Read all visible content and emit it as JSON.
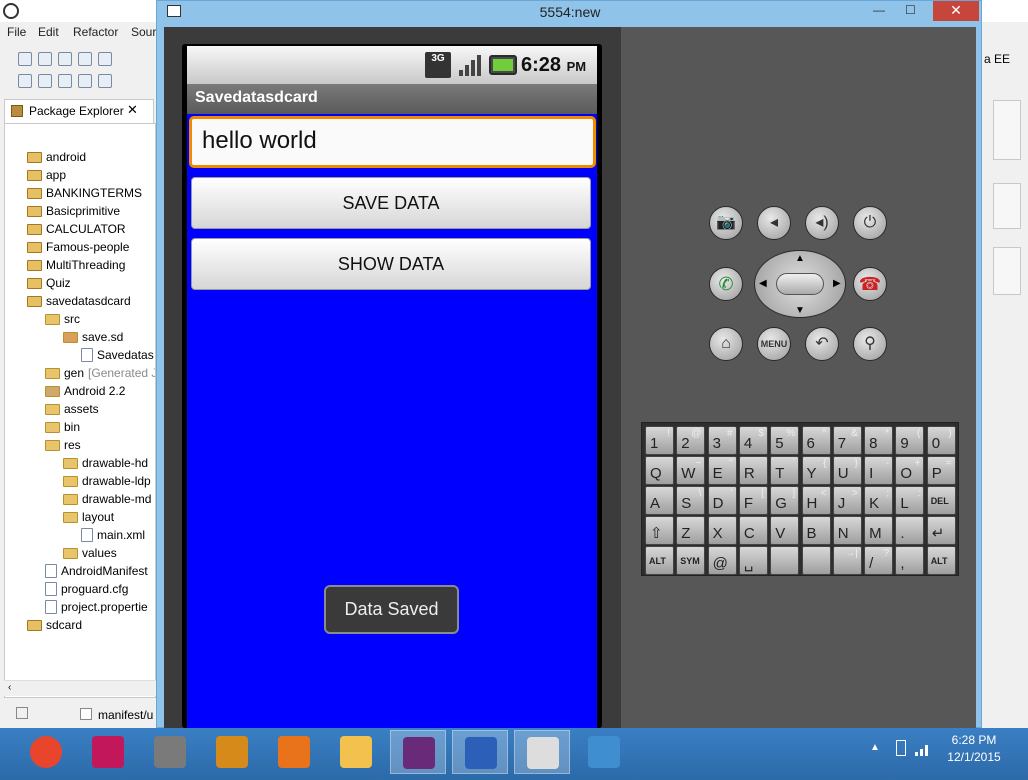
{
  "eclipse": {
    "menu": [
      "File",
      "Edit",
      "Refactor",
      "Sour"
    ],
    "right_fragment": "a EE",
    "package_explorer": {
      "title": "Package Explorer",
      "tree": [
        {
          "label": "android",
          "indent": 0,
          "icon": "project"
        },
        {
          "label": "app",
          "indent": 0,
          "icon": "project"
        },
        {
          "label": "BANKINGTERMS",
          "indent": 0,
          "icon": "project"
        },
        {
          "label": "Basicprimitive",
          "indent": 0,
          "icon": "project"
        },
        {
          "label": "CALCULATOR",
          "indent": 0,
          "icon": "project"
        },
        {
          "label": "Famous-people",
          "indent": 0,
          "icon": "project"
        },
        {
          "label": "MultiThreading",
          "indent": 0,
          "icon": "project"
        },
        {
          "label": "Quiz",
          "indent": 0,
          "icon": "project"
        },
        {
          "label": "savedatasdcard",
          "indent": 0,
          "icon": "project"
        },
        {
          "label": "src",
          "indent": 1,
          "icon": "folder"
        },
        {
          "label": "save.sd",
          "indent": 2,
          "icon": "package"
        },
        {
          "label": "Savedatas",
          "indent": 3,
          "icon": "file"
        },
        {
          "label": "gen",
          "suffix": "[Generated J",
          "indent": 1,
          "icon": "folder"
        },
        {
          "label": "Android 2.2",
          "indent": 1,
          "icon": "jar"
        },
        {
          "label": "assets",
          "indent": 1,
          "icon": "folder"
        },
        {
          "label": "bin",
          "indent": 1,
          "icon": "folder"
        },
        {
          "label": "res",
          "indent": 1,
          "icon": "folder"
        },
        {
          "label": "drawable-hd",
          "indent": 2,
          "icon": "folder"
        },
        {
          "label": "drawable-ldp",
          "indent": 2,
          "icon": "folder"
        },
        {
          "label": "drawable-md",
          "indent": 2,
          "icon": "folder"
        },
        {
          "label": "layout",
          "indent": 2,
          "icon": "folder"
        },
        {
          "label": "main.xml",
          "indent": 3,
          "icon": "file"
        },
        {
          "label": "values",
          "indent": 2,
          "icon": "folder"
        },
        {
          "label": "AndroidManifest",
          "indent": 1,
          "icon": "file"
        },
        {
          "label": "proguard.cfg",
          "indent": 1,
          "icon": "file"
        },
        {
          "label": "project.propertie",
          "indent": 1,
          "icon": "file"
        },
        {
          "label": "sdcard",
          "indent": 0,
          "icon": "project"
        }
      ]
    },
    "bottom_tab": "manifest/u"
  },
  "emulator": {
    "window_title": "5554:new",
    "status": {
      "network": "3G",
      "time": "6:28",
      "ampm": "PM"
    },
    "app": {
      "title": "Savedatasdcard",
      "edit_value": "hello world",
      "save_button": "SAVE DATA",
      "show_button": "SHOW DATA",
      "toast": "Data Saved"
    },
    "controls": {
      "menu_label": "MENU"
    },
    "keyboard": [
      [
        {
          "m": "1",
          "s": "!"
        },
        {
          "m": "2",
          "s": "@"
        },
        {
          "m": "3",
          "s": "#"
        },
        {
          "m": "4",
          "s": "$"
        },
        {
          "m": "5",
          "s": "%"
        },
        {
          "m": "6",
          "s": "^"
        },
        {
          "m": "7",
          "s": "&"
        },
        {
          "m": "8",
          "s": "*"
        },
        {
          "m": "9",
          "s": "("
        },
        {
          "m": "0",
          "s": ")"
        }
      ],
      [
        {
          "m": "Q",
          "s": ""
        },
        {
          "m": "W",
          "s": "~"
        },
        {
          "m": "E",
          "s": "\""
        },
        {
          "m": "R",
          "s": ""
        },
        {
          "m": "T",
          "s": "`"
        },
        {
          "m": "Y",
          "s": "{"
        },
        {
          "m": "U",
          "s": "}"
        },
        {
          "m": "I",
          "s": "-"
        },
        {
          "m": "O",
          "s": "+"
        },
        {
          "m": "P",
          "s": "="
        }
      ],
      [
        {
          "m": "A",
          "s": ""
        },
        {
          "m": "S",
          "s": "\\"
        },
        {
          "m": "D",
          "s": "'"
        },
        {
          "m": "F",
          "s": "["
        },
        {
          "m": "G",
          "s": "]"
        },
        {
          "m": "H",
          "s": "<"
        },
        {
          "m": "J",
          "s": ">"
        },
        {
          "m": "K",
          "s": ";"
        },
        {
          "m": "L",
          "s": ":"
        },
        {
          "m": "DEL",
          "s": ""
        }
      ],
      [
        {
          "m": "⇧",
          "s": ""
        },
        {
          "m": "Z",
          "s": ""
        },
        {
          "m": "X",
          "s": ""
        },
        {
          "m": "C",
          "s": ""
        },
        {
          "m": "V",
          "s": ""
        },
        {
          "m": "B",
          "s": ""
        },
        {
          "m": "N",
          "s": ""
        },
        {
          "m": "M",
          "s": ""
        },
        {
          "m": ".",
          "s": ""
        },
        {
          "m": "↵",
          "s": ""
        }
      ],
      [
        {
          "m": "ALT",
          "s": ""
        },
        {
          "m": "SYM",
          "s": ""
        },
        {
          "m": "@",
          "s": ""
        },
        {
          "m": "␣",
          "s": ""
        },
        {
          "m": "",
          "s": ""
        },
        {
          "m": "",
          "s": ""
        },
        {
          "m": "",
          "s": "→|"
        },
        {
          "m": "/",
          "s": "?"
        },
        {
          "m": ",",
          "s": ""
        },
        {
          "m": "ALT",
          "s": ""
        }
      ]
    ]
  },
  "taskbar": {
    "apps": [
      "chrome-icon",
      "help-icon",
      "firewall-icon",
      "winword-icon",
      "firefox-icon",
      "explorer-icon",
      "javaee-ide-icon",
      "word-icon",
      "eclipse-window-icon",
      "paint-icon"
    ],
    "active": [
      6,
      7,
      8
    ],
    "time": "6:28 PM",
    "date": "12/1/2015"
  }
}
